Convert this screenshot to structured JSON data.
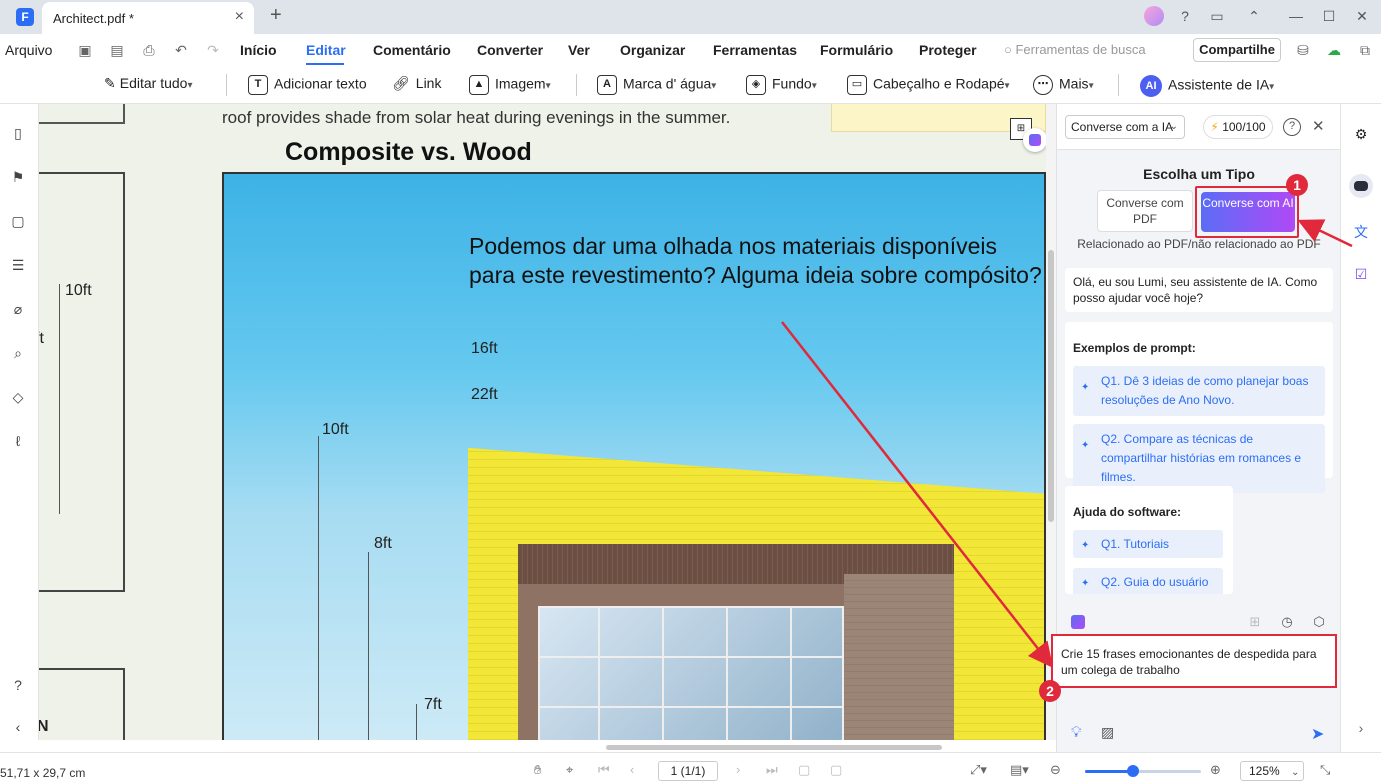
{
  "window": {
    "tab_title": "Architect.pdf *",
    "close_glyph": "×",
    "add_glyph": "+"
  },
  "menu": {
    "file": "Arquivo",
    "items": [
      "Início",
      "Editar",
      "Comentário",
      "Converter",
      "Ver",
      "Organizar",
      "Ferramentas",
      "Formulário",
      "Proteger"
    ],
    "active": "Editar",
    "search_placeholder": "Ferramentas de busca",
    "share": "Compartilhe"
  },
  "ribbon": {
    "edit_all": "Editar tudo",
    "add_text": "Adicionar texto",
    "link": "Link",
    "image": "Imagem",
    "watermark": "Marca d' água",
    "background": "Fundo",
    "header_footer": "Cabeçalho e Rodapé",
    "more": "Mais",
    "ai_assistant": "Assistente de IA",
    "ai_badge": "AI"
  },
  "document": {
    "caption": "roof provides shade from solar heat during evenings in the summer.",
    "title": "Composite vs. Wood",
    "body": "Podemos dar uma olhada nos materiais disponíveis para este revestimento? Alguma ideia sobre compósito?",
    "dimensions": {
      "d16": "16ft",
      "d22": "22ft",
      "d10a": "10ft",
      "d10b": "10ft",
      "d8": "8ft",
      "d7": "7ft",
      "dft": "ft",
      "dN": "N"
    }
  },
  "ai_panel": {
    "mode_select": "Converse com a IA",
    "credits": "100/100",
    "choose_type_title": "Escolha um Tipo",
    "type_pdf": "Converse com PDF",
    "type_ai": "Converse com AI",
    "type_subtitle": "Relacionado ao PDF/não relacionado ao PDF",
    "greeting": "Olá, eu sou Lumi, seu assistente de IA. Como posso ajudar você hoje?",
    "examples_title": "Exemplos de prompt:",
    "examples": [
      "Q1. Dê 3 ideias de como planejar boas resoluções de Ano Novo.",
      "Q2. Compare as técnicas de compartilhar histórias em romances e filmes."
    ],
    "help_title": "Ajuda do software:",
    "help_items": [
      "Q1. Tutoriais",
      "Q2. Guia do usuário"
    ],
    "input_value": "Crie 15 frases emocionantes de despedida para um colega de trabalho",
    "badge_1": "1",
    "badge_2": "2"
  },
  "status": {
    "page_size": "51,71 x 29,7 cm",
    "page_indicator": "1 (1/1)",
    "zoom": "125%",
    "zoom_fraction": 0.41
  },
  "colors": {
    "accent": "#2b6ef5",
    "highlight_red": "#e0293b"
  }
}
